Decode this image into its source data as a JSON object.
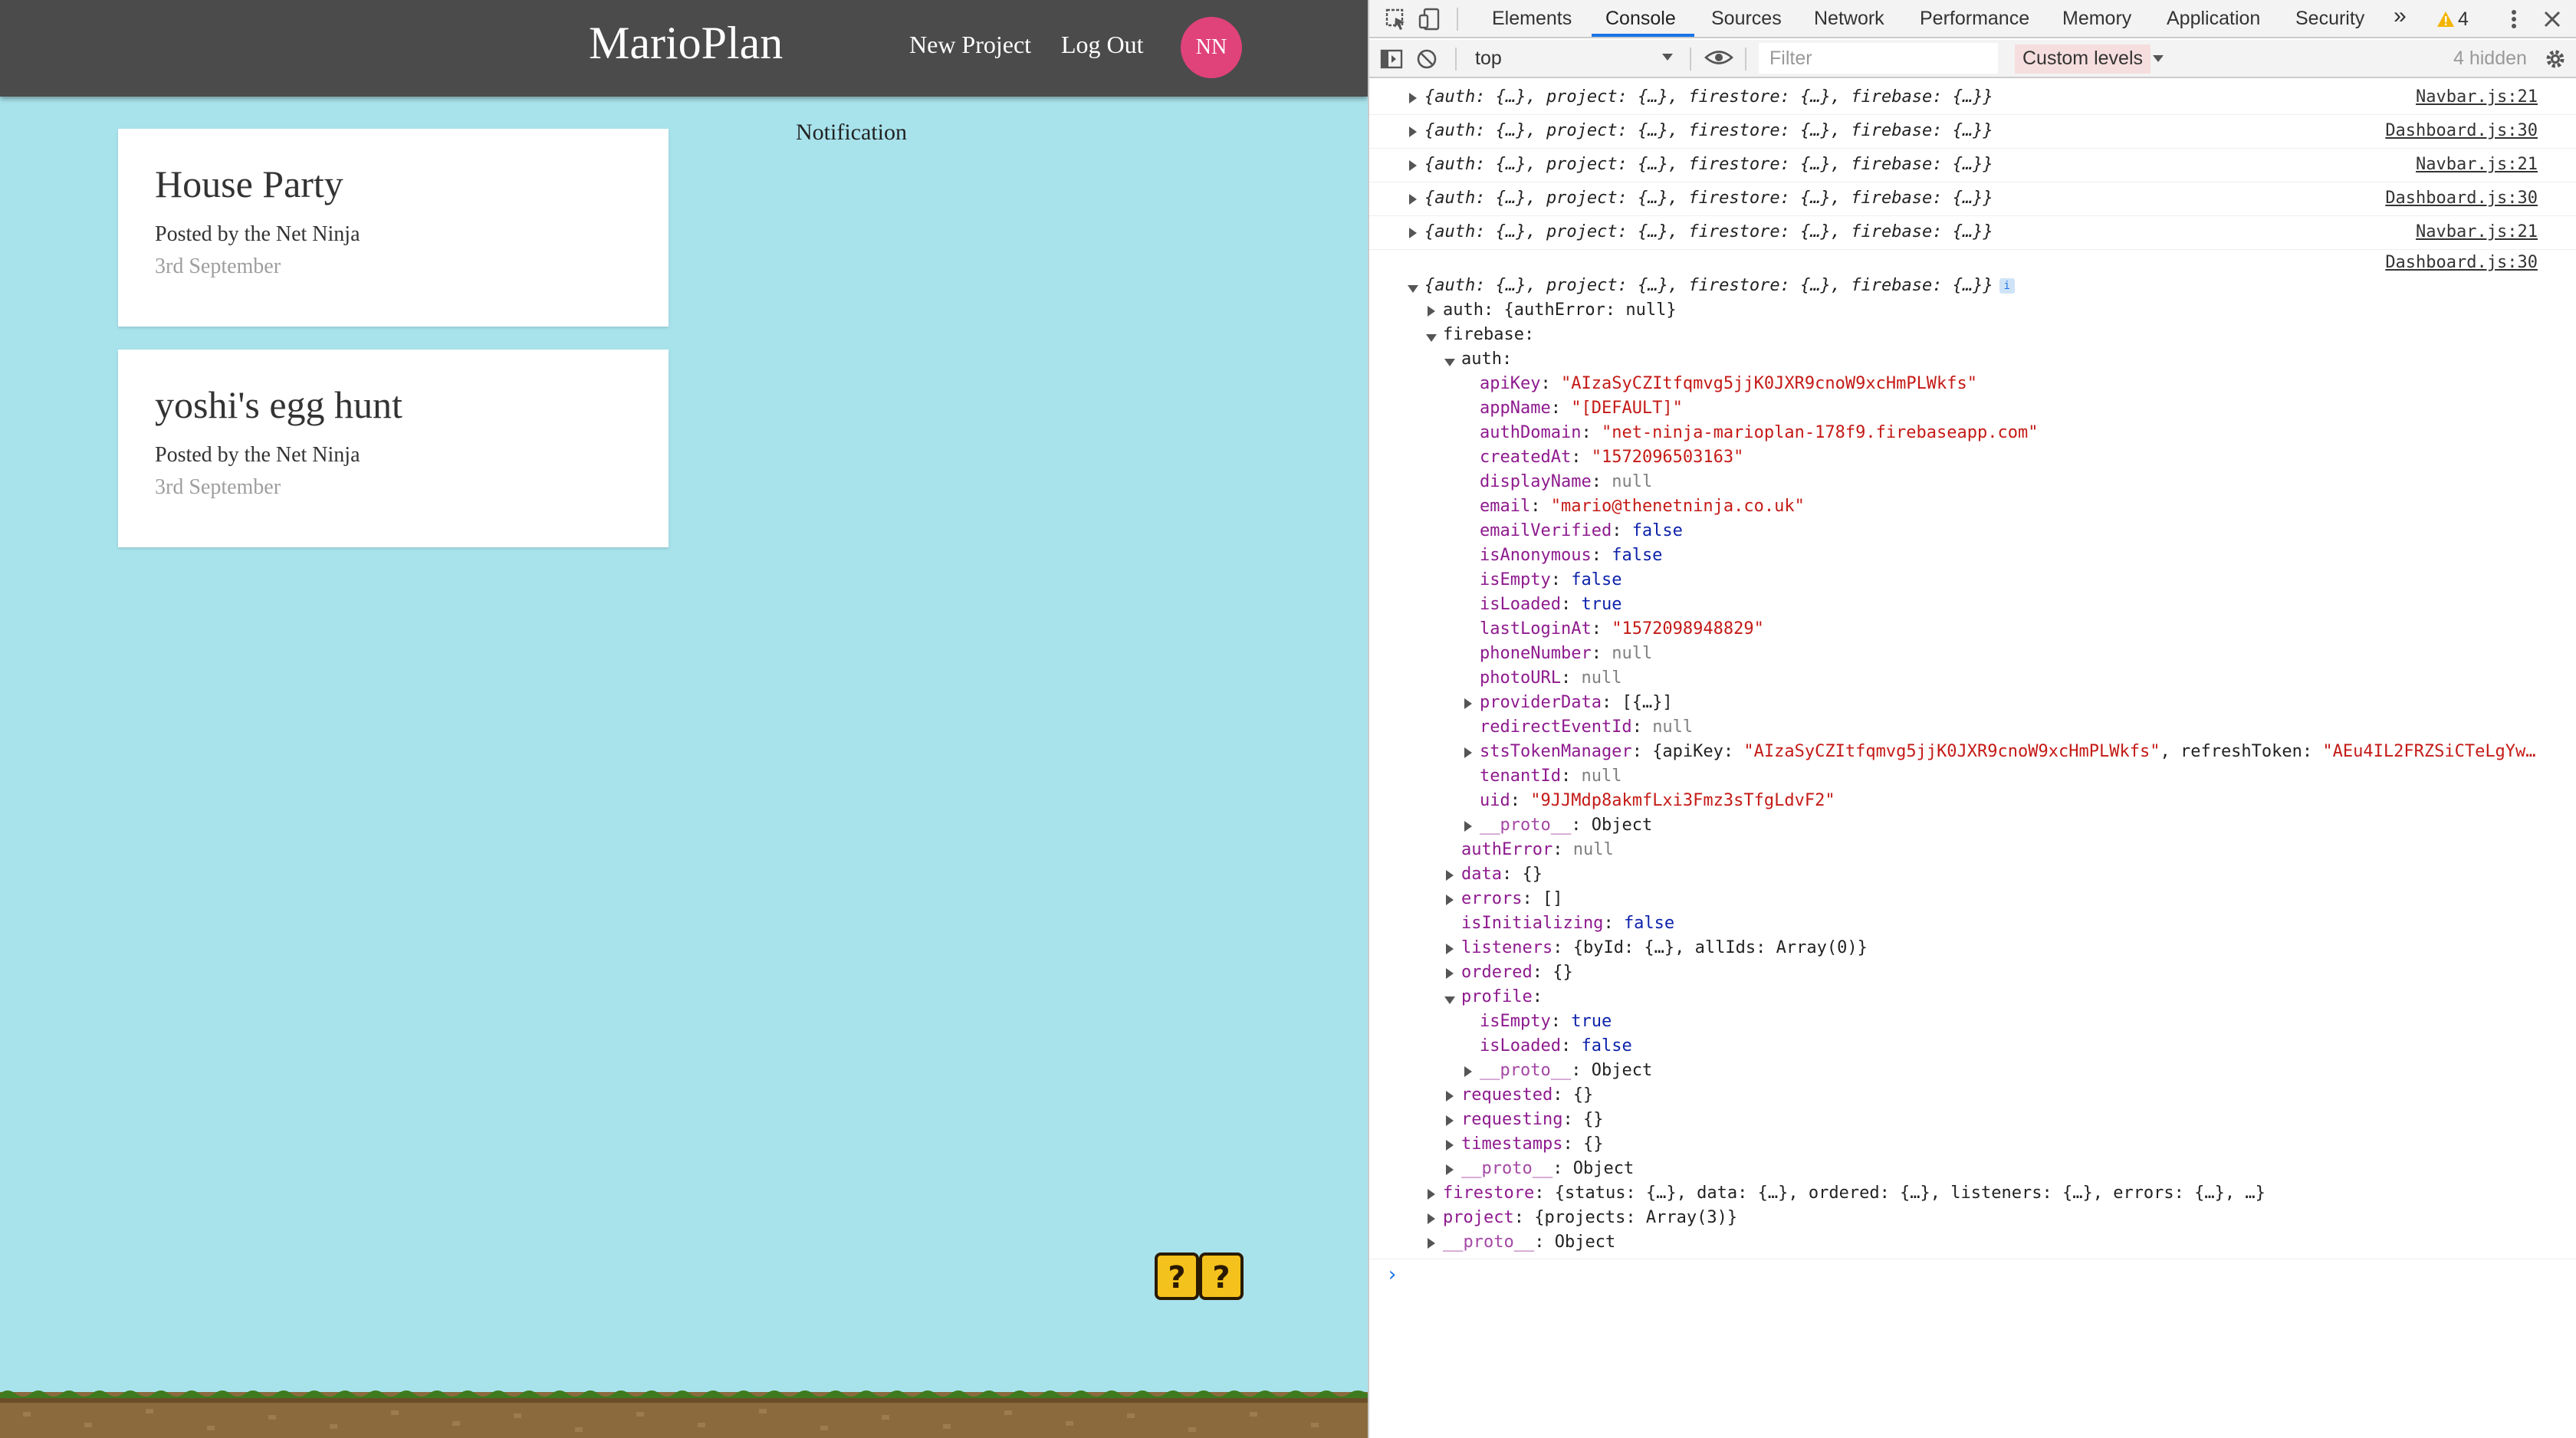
{
  "app": {
    "brand": "MarioPlan",
    "nav": {
      "new_project": "New Project",
      "log_out": "Log Out",
      "avatar_initials": "NN"
    },
    "projects": [
      {
        "title": "House Party",
        "author": "Posted by the Net Ninja",
        "date": "3rd September"
      },
      {
        "title": "yoshi's egg hunt",
        "author": "Posted by the Net Ninja",
        "date": "3rd September"
      }
    ],
    "notification": "Notification",
    "colors": {
      "background": "#a8e3ec",
      "navbar": "#4b4b4b",
      "avatar": "#e0427a"
    }
  },
  "devtools": {
    "tabs": [
      "Elements",
      "Console",
      "Sources",
      "Network",
      "Performance",
      "Memory",
      "Application",
      "Security"
    ],
    "active_tab": "Console",
    "more_tabs": "»",
    "warning_count": "4",
    "context": "top",
    "filter_placeholder": "Filter",
    "levels": "Custom levels",
    "hidden": "4 hidden",
    "collapsed_logs": [
      {
        "text": "{auth: {…}, project: {…}, firestore: {…}, firebase: {…}}",
        "source": "Navbar.js:21"
      },
      {
        "text": "{auth: {…}, project: {…}, firestore: {…}, firebase: {…}}",
        "source": "Dashboard.js:30"
      },
      {
        "text": "{auth: {…}, project: {…}, firestore: {…}, firebase: {…}}",
        "source": "Navbar.js:21"
      },
      {
        "text": "{auth: {…}, project: {…}, firestore: {…}, firebase: {…}}",
        "source": "Dashboard.js:30"
      },
      {
        "text": "{auth: {…}, project: {…}, firestore: {…}, firebase: {…}}",
        "source": "Navbar.js:21"
      }
    ],
    "expanded_log": {
      "source": "Dashboard.js:30",
      "summary": "{auth: {…}, project: {…}, firestore: {…}, firebase: {…}}",
      "auth_line": "auth: {authError: null}",
      "firebase_key": "firebase:",
      "auth_key": "auth:",
      "auth_fields": {
        "apiKey": "\"AIzaSyCZItfqmvg5jjK0JXR9cnoW9xcHmPLWkfs\"",
        "appName": "\"[DEFAULT]\"",
        "authDomain": "\"net-ninja-marioplan-178f9.firebaseapp.com\"",
        "createdAt": "\"1572096503163\"",
        "displayName": "null",
        "email": "\"mario@thenetninja.co.uk\"",
        "emailVerified": "false",
        "isAnonymous": "false",
        "isEmpty": "false",
        "isLoaded": "true",
        "lastLoginAt": "\"1572098948829\"",
        "phoneNumber": "null",
        "photoURL": "null",
        "providerData": "[{…}]",
        "redirectEventId": "null",
        "stsTokenManager_pre": "{apiKey: ",
        "stsTokenManager_key": "\"AIzaSyCZItfqmvg5jjK0JXR9cnoW9xcHmPLWkfs\"",
        "stsTokenManager_mid": ", refreshToken: ",
        "stsTokenManager_tok": "\"AEu4IL2FRZSiCTeLgYw…",
        "tenantId": "null",
        "uid": "\"9JJMdp8akmfLxi3Fmz3sTfgLdvF2\"",
        "proto": "Object"
      },
      "firebase_fields": {
        "authError": "null",
        "data": "{}",
        "errors": "[]",
        "isInitializing": "false",
        "listeners": "{byId: {…}, allIds: Array(0)}",
        "ordered": "{}",
        "profile_isEmpty": "true",
        "profile_isLoaded": "false",
        "profile_proto": "Object",
        "requested": "{}",
        "requesting": "{}",
        "timestamps": "{}",
        "proto": "Object"
      },
      "firestore": "{status: {…}, data: {…}, ordered: {…}, listeners: {…}, errors: {…}, …}",
      "project": "{projects: Array(3)}",
      "proto": "Object"
    },
    "prompt": "›"
  }
}
